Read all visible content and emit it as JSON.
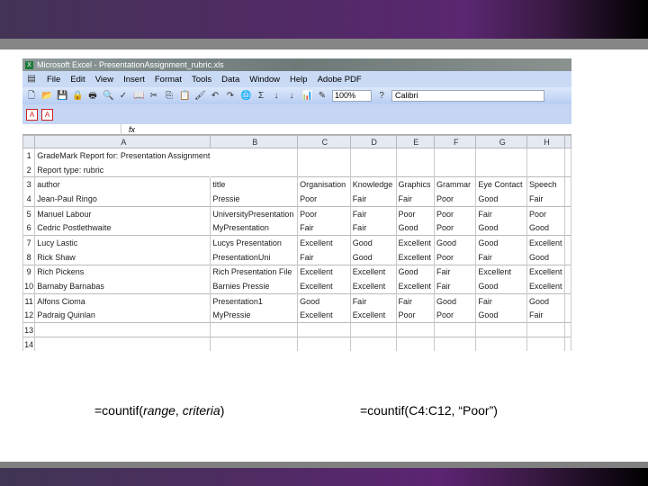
{
  "slide": {
    "formula_generic": {
      "prefix": "=countif(",
      "arg1": "range",
      "sep": ", ",
      "arg2": "criteria",
      "suffix": ")"
    },
    "formula_example": "=countif(C4:C12, “Poor”)",
    "colors": {
      "header_bar": "#5a2770",
      "divider": "#858585"
    }
  },
  "excel": {
    "title": "Microsoft Excel - PresentationAssignment_rubric.xls",
    "menu": [
      "File",
      "Edit",
      "View",
      "Insert",
      "Format",
      "Tools",
      "Data",
      "Window",
      "Help",
      "Adobe PDF"
    ],
    "toolbar": {
      "zoom": "100%",
      "font": "Calibri"
    },
    "formula_bar": {
      "fx": "fx",
      "value": ""
    },
    "columns": [
      "A",
      "B",
      "C",
      "D",
      "E",
      "F",
      "G",
      "H",
      ""
    ],
    "rows": [
      [
        "GradeMark Report for: Presentation Assignment",
        "",
        "",
        "",
        "",
        "",
        "",
        "",
        ""
      ],
      [
        "Report type: rubric",
        "",
        "",
        "",
        "",
        "",
        "",
        "",
        ""
      ],
      [
        "author",
        "title",
        "Organisation",
        "Knowledge",
        "Graphics",
        "Grammar",
        "Eye Contact",
        "Speech",
        ""
      ],
      [
        "Jean-Paul Ringo",
        "Pressie",
        "Poor",
        "Fair",
        "Fair",
        "Poor",
        "Good",
        "Fair",
        ""
      ],
      [
        "Manuel Labour",
        "UniversityPresentation",
        "Poor",
        "Fair",
        "Poor",
        "Poor",
        "Fair",
        "Poor",
        ""
      ],
      [
        "Cedric Postlethwaite",
        "MyPresentation",
        "Fair",
        "Fair",
        "Good",
        "Poor",
        "Good",
        "Good",
        ""
      ],
      [
        "Lucy Lastic",
        "Lucys Presentation",
        "Excellent",
        "Good",
        "Excellent",
        "Good",
        "Good",
        "Excellent",
        ""
      ],
      [
        "Rick Shaw",
        "PresentationUni",
        "Fair",
        "Good",
        "Excellent",
        "Poor",
        "Fair",
        "Good",
        ""
      ],
      [
        "Rich Pickens",
        "Rich Presentation File",
        "Excellent",
        "Excellent",
        "Good",
        "Fair",
        "Excellent",
        "Excellent",
        ""
      ],
      [
        "Barnaby Barnabas",
        "Barnies Pressie",
        "Excellent",
        "Excellent",
        "Excellent",
        "Fair",
        "Good",
        "Excellent",
        ""
      ],
      [
        "Alfons Cioma",
        "Presentation1",
        "Good",
        "Fair",
        "Fair",
        "Good",
        "Fair",
        "Good",
        ""
      ],
      [
        "Padraig Quinlan",
        "MyPressie",
        "Excellent",
        "Excellent",
        "Poor",
        "Poor",
        "Good",
        "Fair",
        ""
      ],
      [
        "",
        "",
        "",
        "",
        "",
        "",
        "",
        "",
        ""
      ],
      [
        "",
        "",
        "",
        "",
        "",
        "",
        "",
        "",
        ""
      ]
    ]
  }
}
